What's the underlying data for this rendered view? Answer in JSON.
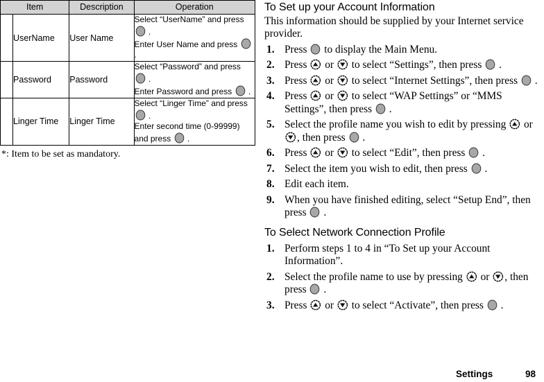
{
  "table": {
    "headers": [
      "Item",
      "Description",
      "Operation"
    ],
    "rows": [
      {
        "mark": "",
        "item": "UserName",
        "description": "User Name",
        "operation_lines": [
          "Select “UserName” and press ",
          "Enter User Name and press "
        ]
      },
      {
        "mark": "",
        "item": "Password",
        "description": "Password",
        "operation_lines": [
          "Select “Password” and press ",
          "Enter Password and press "
        ]
      },
      {
        "mark": "",
        "item": "Linger Time",
        "description": "Linger Time",
        "operation_lines": [
          "Select “Linger Time” and press ",
          "Enter second time (0-99999) and press "
        ]
      }
    ],
    "footnote": "*: Item to be set as mandatory."
  },
  "section1": {
    "heading": "To Set up your Account Information",
    "intro": "This information should be supplied by your Internet service provider.",
    "steps": [
      {
        "num": "1.",
        "parts": [
          {
            "t": "text",
            "v": "Press "
          },
          {
            "t": "icon",
            "v": "center-select-key-icon"
          },
          {
            "t": "text",
            "v": " to display the Main Menu."
          }
        ]
      },
      {
        "num": "2.",
        "parts": [
          {
            "t": "text",
            "v": "Press "
          },
          {
            "t": "icon",
            "v": "up-arrow-key-icon"
          },
          {
            "t": "text",
            "v": " or "
          },
          {
            "t": "icon",
            "v": "down-arrow-key-icon"
          },
          {
            "t": "text",
            "v": " to select “Settings”, then press "
          },
          {
            "t": "icon",
            "v": "center-select-key-icon"
          },
          {
            "t": "text",
            "v": " ."
          }
        ]
      },
      {
        "num": "3.",
        "parts": [
          {
            "t": "text",
            "v": "Press "
          },
          {
            "t": "icon",
            "v": "up-arrow-key-icon"
          },
          {
            "t": "text",
            "v": " or "
          },
          {
            "t": "icon",
            "v": "down-arrow-key-icon"
          },
          {
            "t": "text",
            "v": " to select “Internet Settings”, then press "
          },
          {
            "t": "icon",
            "v": "center-select-key-icon"
          },
          {
            "t": "text",
            "v": " ."
          }
        ]
      },
      {
        "num": "4.",
        "parts": [
          {
            "t": "text",
            "v": "Press "
          },
          {
            "t": "icon",
            "v": "up-arrow-key-icon"
          },
          {
            "t": "text",
            "v": " or "
          },
          {
            "t": "icon",
            "v": "down-arrow-key-icon"
          },
          {
            "t": "text",
            "v": " to select “WAP Settings” or “MMS Settings”, then press "
          },
          {
            "t": "icon",
            "v": "center-select-key-icon"
          },
          {
            "t": "text",
            "v": " ."
          }
        ]
      },
      {
        "num": "5.",
        "parts": [
          {
            "t": "text",
            "v": "Select the profile name you wish to edit by pressing "
          },
          {
            "t": "icon",
            "v": "up-arrow-key-icon"
          },
          {
            "t": "text",
            "v": " or "
          },
          {
            "t": "icon",
            "v": "down-arrow-key-icon"
          },
          {
            "t": "text",
            "v": ", then press "
          },
          {
            "t": "icon",
            "v": "center-select-key-icon"
          },
          {
            "t": "text",
            "v": " ."
          }
        ]
      },
      {
        "num": "6.",
        "parts": [
          {
            "t": "text",
            "v": "Press "
          },
          {
            "t": "icon",
            "v": "up-arrow-key-icon"
          },
          {
            "t": "text",
            "v": " or "
          },
          {
            "t": "icon",
            "v": "down-arrow-key-icon"
          },
          {
            "t": "text",
            "v": " to select “Edit”, then press "
          },
          {
            "t": "icon",
            "v": "center-select-key-icon"
          },
          {
            "t": "text",
            "v": " ."
          }
        ]
      },
      {
        "num": "7.",
        "parts": [
          {
            "t": "text",
            "v": "Select the item you wish to edit, then press "
          },
          {
            "t": "icon",
            "v": "center-select-key-icon"
          },
          {
            "t": "text",
            "v": " ."
          }
        ]
      },
      {
        "num": "8.",
        "parts": [
          {
            "t": "text",
            "v": "Edit each item."
          }
        ]
      },
      {
        "num": "9.",
        "parts": [
          {
            "t": "text",
            "v": "When you have finished editing, select “Setup End”, then press "
          },
          {
            "t": "icon",
            "v": "center-select-key-icon"
          },
          {
            "t": "text",
            "v": " ."
          }
        ]
      }
    ]
  },
  "section2": {
    "heading": "To Select Network Connection Profile",
    "steps": [
      {
        "num": "1.",
        "parts": [
          {
            "t": "text",
            "v": "Perform steps 1 to 4 in “To Set up your Account Information”."
          }
        ]
      },
      {
        "num": "2.",
        "parts": [
          {
            "t": "text",
            "v": "Select the profile name to use by pressing "
          },
          {
            "t": "icon",
            "v": "up-arrow-key-icon"
          },
          {
            "t": "text",
            "v": " or "
          },
          {
            "t": "icon",
            "v": "down-arrow-key-icon"
          },
          {
            "t": "text",
            "v": ", then press "
          },
          {
            "t": "icon",
            "v": "center-select-key-icon"
          },
          {
            "t": "text",
            "v": " ."
          }
        ]
      },
      {
        "num": "3.",
        "parts": [
          {
            "t": "text",
            "v": "Press "
          },
          {
            "t": "icon",
            "v": "up-arrow-key-icon"
          },
          {
            "t": "text",
            "v": " or "
          },
          {
            "t": "icon",
            "v": "down-arrow-key-icon"
          },
          {
            "t": "text",
            "v": " to select “Activate”, then press "
          },
          {
            "t": "icon",
            "v": "center-select-key-icon"
          },
          {
            "t": "text",
            "v": " ."
          }
        ]
      }
    ]
  },
  "footer": {
    "section_label": "Settings",
    "page_number": "98"
  },
  "colors": {
    "header_fill": "#d3d3d3",
    "key_fill": "#a8a8a8",
    "rule": "#000000",
    "text": "#000000"
  }
}
